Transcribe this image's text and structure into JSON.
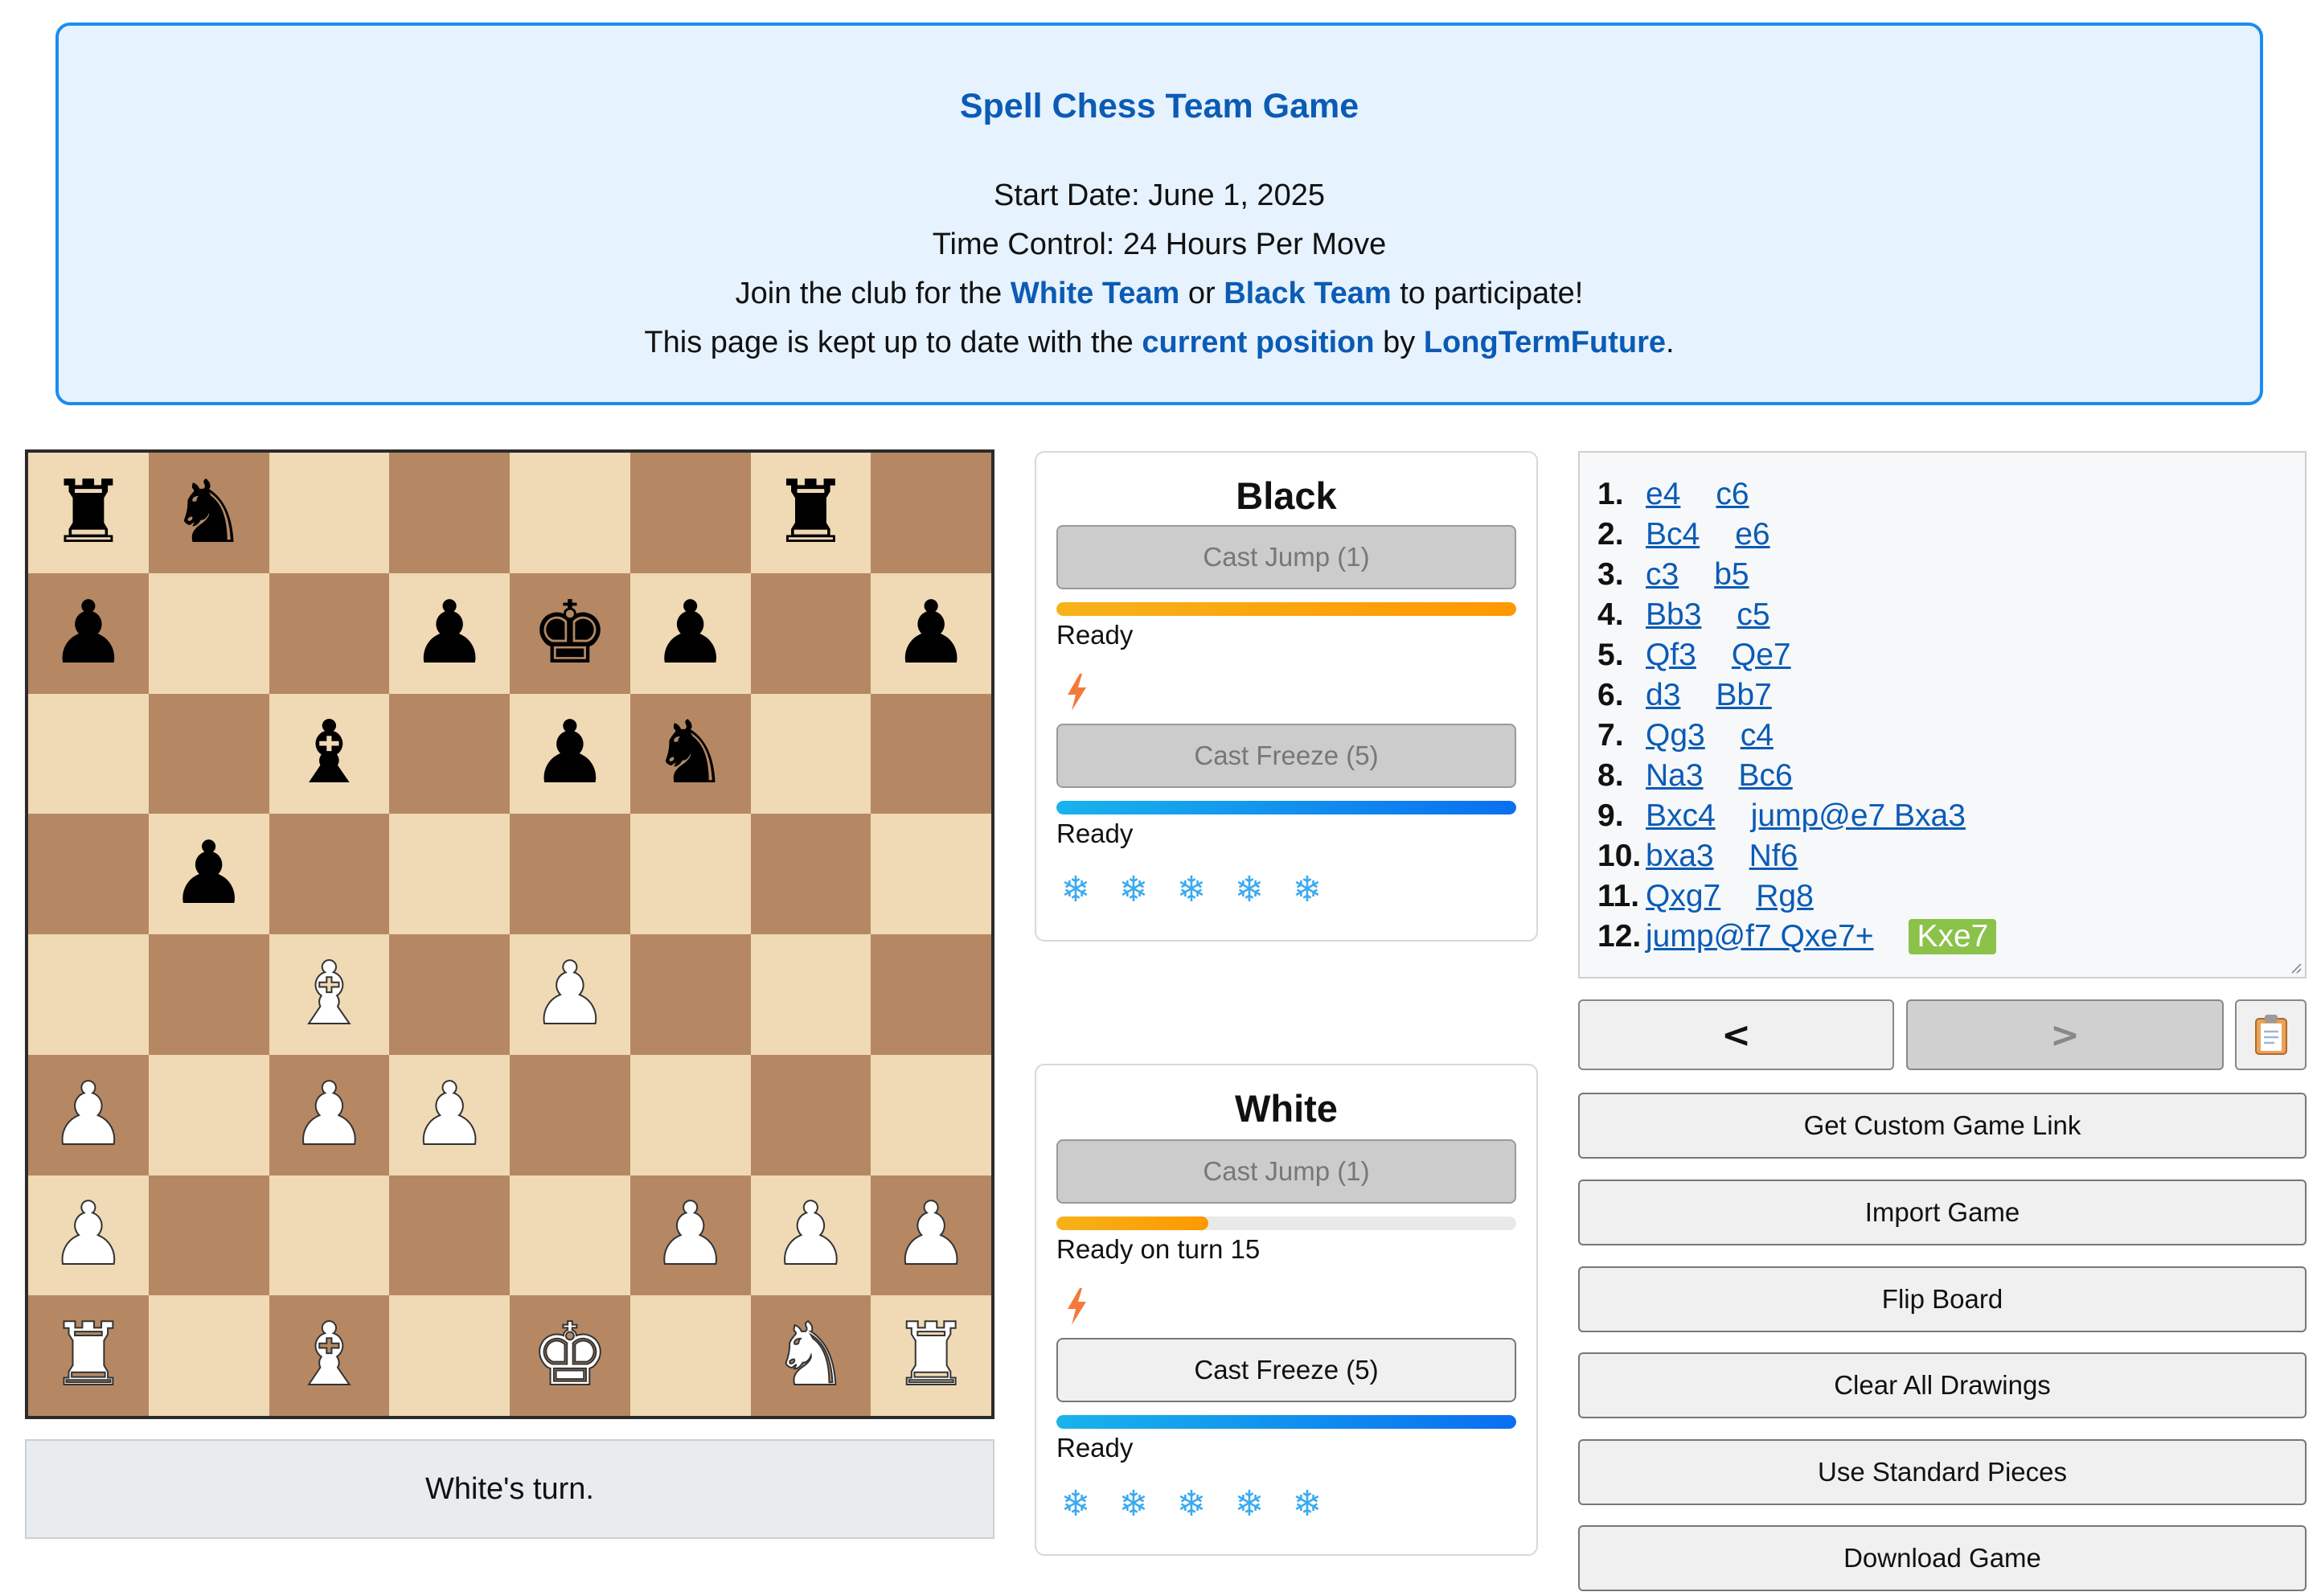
{
  "header": {
    "title": "Spell Chess Team Game",
    "start_date": "Start Date: June 1, 2025",
    "time_control": "Time Control: 24 Hours Per Move",
    "join_prefix": "Join the club for the",
    "white_team_link": "White Team",
    "join_or": "or",
    "black_team_link": "Black Team",
    "join_suffix": "to participate!",
    "update_prefix": "This page is kept up to date with the",
    "current_position_link": "current position",
    "update_by": "by",
    "author_link": "LongTermFuture",
    "update_suffix": "."
  },
  "board": {
    "ranks": [
      "r n . . . . r .",
      "p . . p k p . p",
      ". . b . p n . .",
      ". p . . . . . .",
      ". . B . P . . .",
      "P . P P . . . .",
      "P . . . . P P P",
      "R . B . K . N R"
    ],
    "piece_glyphs": {
      "k": "♚",
      "q": "♛",
      "r": "♜",
      "b": "♝",
      "n": "♞",
      "p": "♟",
      "K": "♚",
      "Q": "♛",
      "R": "♜",
      "B": "♝",
      "N": "♞",
      "P": "♟"
    },
    "light_color": "#f0d9b5",
    "dark_color": "#b58863"
  },
  "turn_status": "White's turn.",
  "panels": {
    "black": {
      "title": "Black",
      "jump_button": "Cast Jump (1)",
      "jump_progress": 1.0,
      "jump_status": "Ready",
      "jump_charges_icon": "lightning-bolt-icon",
      "freeze_button": "Cast Freeze (5)",
      "freeze_progress": 1.0,
      "freeze_status": "Ready",
      "freeze_charges": [
        "❄",
        "❄",
        "❄",
        "❄",
        "❄"
      ]
    },
    "white": {
      "title": "White",
      "jump_button": "Cast Jump (1)",
      "jump_progress": 0.33,
      "jump_status": "Ready on turn 15",
      "jump_charges_icon": "lightning-bolt-icon",
      "freeze_button": "Cast Freeze (5)",
      "freeze_progress": 1.0,
      "freeze_status": "Ready",
      "freeze_charges": [
        "❄",
        "❄",
        "❄",
        "❄",
        "❄"
      ]
    }
  },
  "moves": [
    {
      "num": "1.",
      "white": "e4",
      "black": "c6"
    },
    {
      "num": "2.",
      "white": "Bc4",
      "black": "e6"
    },
    {
      "num": "3.",
      "white": "c3",
      "black": "b5"
    },
    {
      "num": "4.",
      "white": "Bb3",
      "black": "c5"
    },
    {
      "num": "5.",
      "white": "Qf3",
      "black": "Qe7"
    },
    {
      "num": "6.",
      "white": "d3",
      "black": "Bb7"
    },
    {
      "num": "7.",
      "white": "Qg3",
      "black": "c4"
    },
    {
      "num": "8.",
      "white": "Na3",
      "black": "Bc6"
    },
    {
      "num": "9.",
      "white": "Bxc4",
      "black": "jump@e7 Bxa3"
    },
    {
      "num": "10.",
      "white": "bxa3",
      "black": "Nf6"
    },
    {
      "num": "11.",
      "white": "Qxg7",
      "black": "Rg8"
    },
    {
      "num": "12.",
      "white": "jump@f7 Qxe7+",
      "black": "Kxe7",
      "current": "black"
    }
  ],
  "nav": {
    "prev": "<",
    "next": ">",
    "copy_icon": "clipboard-icon"
  },
  "actions": [
    "Get Custom Game Link",
    "Import Game",
    "Flip Board",
    "Clear All Drawings",
    "Use Standard Pieces",
    "Download Game"
  ],
  "colors": {
    "accent": "#0b5bb5",
    "info_border": "#1a8cf0",
    "info_bg": "#e6f2fd",
    "current_move": "#8ac24a",
    "jump_bar": "#ff9800",
    "freeze_bar": "#0a6ff0"
  }
}
